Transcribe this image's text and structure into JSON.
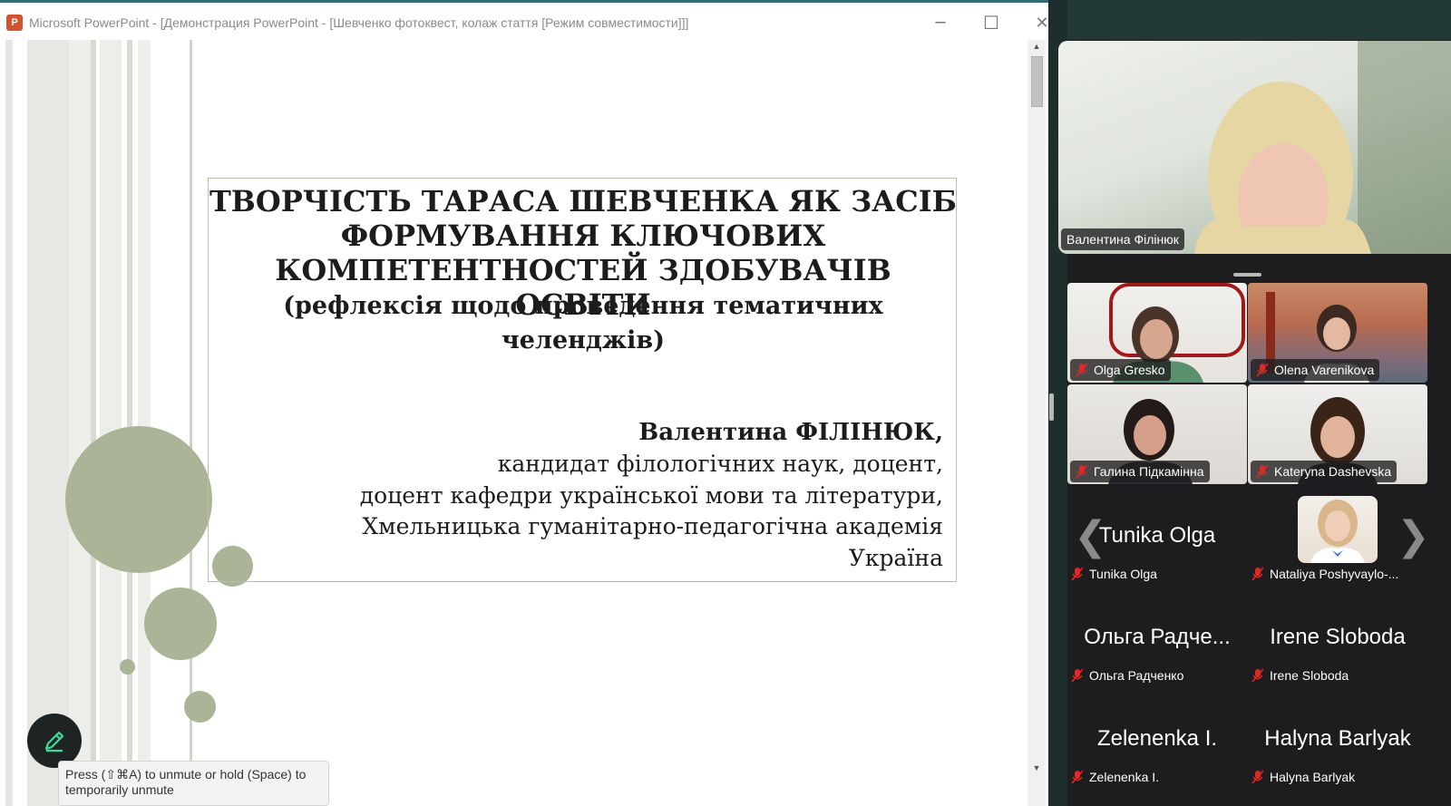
{
  "window": {
    "title": "Microsoft PowerPoint - [Демонстрация PowerPoint - [Шевченко фотоквест, колаж стаття [Режим совместимости]]]",
    "minimize": "─",
    "maximize": "☐",
    "close": "✕",
    "icon": "powerpoint-icon"
  },
  "slide": {
    "title_lines": [
      "ТВОРЧІСТЬ ТАРАСА ШЕВЧЕНКА ЯК ЗАСІБ",
      "ФОРМУВАННЯ КЛЮЧОВИХ",
      "КОМПЕТЕНТНОСТЕЙ ЗДОБУВАЧІВ ОСВІТИ"
    ],
    "subtitle_lines": [
      "(рефлексія щодо проведення тематичних",
      "челенджів)"
    ],
    "author_name": "Валентина ФІЛІНЮК,",
    "author_lines": [
      "кандидат філологічних наук, доцент,",
      "доцент кафедри української мови та літератури,",
      "Хмельницька гуманітарно-педагогічна академія",
      "Україна"
    ],
    "accent_color": "#a9b596"
  },
  "tooltip": {
    "text": "Press (⇧⌘A) to unmute or hold (Space) to temporarily unmute"
  },
  "annotate_button": {
    "icon": "pencil-icon"
  },
  "zoom": {
    "speaker": {
      "name": "Валентина Філінюк"
    },
    "participants": [
      {
        "name": "Olga Gresko",
        "big_label": "",
        "muted": true
      },
      {
        "name": "Olena Varenikova",
        "big_label": "",
        "muted": true
      },
      {
        "name": "Галина Підкамінна",
        "big_label": "",
        "muted": true
      },
      {
        "name": "Kateryna Dashevska",
        "big_label": "",
        "muted": true
      },
      {
        "name": "Tunika Olga",
        "big_label": "Tunika Olga",
        "muted": true
      },
      {
        "name": "Nataliya Poshyvaylo-...",
        "big_label": "",
        "muted": true
      },
      {
        "name": "Ольга Радченко",
        "big_label": "Ольга Радче...",
        "muted": true
      },
      {
        "name": "Irene Sloboda",
        "big_label": "Irene Sloboda",
        "muted": true
      },
      {
        "name": "Zelenenka I.",
        "big_label": "Zelenenka I.",
        "muted": true
      },
      {
        "name": "Halyna Barlyak",
        "big_label": "Halyna Barlyak",
        "muted": true
      }
    ],
    "prev_arrow": "❮",
    "next_arrow": "❯",
    "mute_color": "#e02828"
  }
}
